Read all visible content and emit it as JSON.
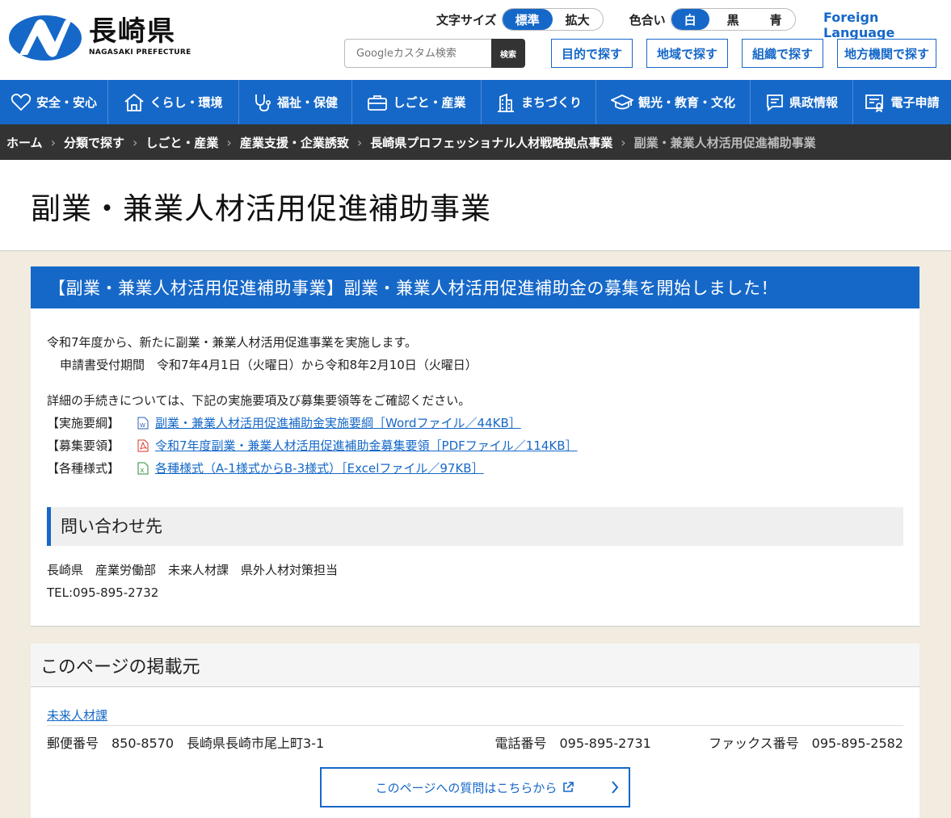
{
  "header": {
    "logo_kanji": "長崎県",
    "logo_roman": "NAGASAKI PREFECTURE",
    "font_size_label": "文字サイズ",
    "font_size_options": [
      "標準",
      "拡大"
    ],
    "color_label": "色合い",
    "color_options": [
      "白",
      "黒",
      "青"
    ],
    "foreign_language": "Foreign Language",
    "search_placeholder": "Googleカスタム検索",
    "search_button": "検索",
    "find_buttons": [
      "目的で探す",
      "地域で探す",
      "組織で探す",
      "地方機関で探す"
    ]
  },
  "gnav": [
    {
      "label": "安全・安心",
      "icon": "heart-icon"
    },
    {
      "label": "くらし・環境",
      "icon": "house-icon"
    },
    {
      "label": "福祉・保健",
      "icon": "stethoscope-icon"
    },
    {
      "label": "しごと・産業",
      "icon": "briefcase-icon"
    },
    {
      "label": "まちづくり",
      "icon": "building-icon"
    },
    {
      "label": "観光・教育・文化",
      "icon": "graduation-cap-icon"
    },
    {
      "label": "県政情報",
      "icon": "speech-bubble-icon"
    },
    {
      "label": "電子申請",
      "icon": "certificate-icon"
    }
  ],
  "breadcrumb": [
    "ホーム",
    "分類で探す",
    "しごと・産業",
    "産業支援・企業誘致",
    "長崎県プロフェッショナル人材戦略拠点事業",
    "副業・兼業人材活用促進補助事業"
  ],
  "page_title": "副業・兼業人材活用促進補助事業",
  "article": {
    "heading": "【副業・兼業人材活用促進補助事業】副業・兼業人材活用促進補助金の募集を開始しました！",
    "intro": "令和7年度から、新たに副業・兼業人材活用促進事業を実施します。",
    "period": "申請書受付期間　令和7年4月1日（火曜日）から令和8年2月10日（火曜日）",
    "details_intro": "詳細の手続きについては、下記の実施要項及び募集要領等をご確認ください。",
    "documents": [
      {
        "label": "【実施要綱】",
        "text": "副業・兼業人材活用促進補助金実施要綱［Wordファイル／44KB］",
        "type": "word",
        "color": "#2b5fb8"
      },
      {
        "label": "【募集要領】",
        "text": "令和7年度副業・兼業人材活用促進補助金募集要領［PDFファイル／114KB］",
        "type": "pdf",
        "color": "#d9342b"
      },
      {
        "label": "【各種様式】",
        "text": "各種様式（A-1様式からB-3様式）［Excelファイル／97KB］",
        "type": "excel",
        "color": "#2e8b3a"
      }
    ],
    "contact_heading": "問い合わせ先",
    "contact_org": "長崎県　産業労働部　未来人材課　県外人材対策担当",
    "contact_tel": "TEL:095-895-2732"
  },
  "publisher": {
    "heading": "このページの掲載元",
    "department": "未来人材課",
    "address": "郵便番号　850-8570　長崎県長崎市尾上町3-1",
    "phone": "電話番号　095-895-2731",
    "fax": "ファックス番号　095-895-2582",
    "question_button": "このページへの質問はこちらから"
  },
  "colors": {
    "brand": "#1668c8",
    "breadcrumb_bg": "#333333",
    "page_bg": "#f1ebe0"
  }
}
